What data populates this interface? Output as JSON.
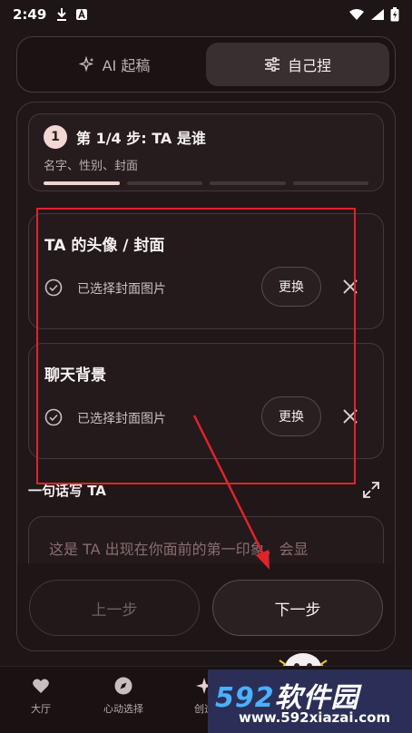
{
  "status_bar": {
    "time": "2:49"
  },
  "mode_switch": {
    "tabs": [
      {
        "label": "AI 起稿",
        "icon": "sparkle-icon",
        "active": false
      },
      {
        "label": "自己捏",
        "icon": "sliders-icon",
        "active": true
      }
    ]
  },
  "step": {
    "number": "1",
    "title": "第 1/4 步: TA 是谁",
    "subtitle": "名字、性别、封面",
    "progress": {
      "current": 1,
      "total": 4
    }
  },
  "cards": [
    {
      "title": "TA 的头像 / 封面",
      "status": "已选择封面图片",
      "change_label": "更换"
    },
    {
      "title": "聊天背景",
      "status": "已选择封面图片",
      "change_label": "更换"
    }
  ],
  "intro": {
    "label": "一句话写 TA",
    "placeholder": "这是 TA 出现在你面前的第一印象，会显"
  },
  "actions": {
    "prev_label": "上一步",
    "next_label": "下一步"
  },
  "bottom_nav": {
    "items": [
      {
        "label": "大厅",
        "icon": "heart-icon"
      },
      {
        "label": "心动选择",
        "icon": "compass-icon"
      },
      {
        "label": "创造",
        "icon": "sparkle-icon"
      }
    ]
  },
  "watermark": {
    "brand_num": "592",
    "brand_text": "软件园",
    "url": "www.592xiazai.com"
  },
  "colors": {
    "accent": "#efd3cc",
    "annotation": "#e0232b",
    "background": "#1e1516"
  }
}
